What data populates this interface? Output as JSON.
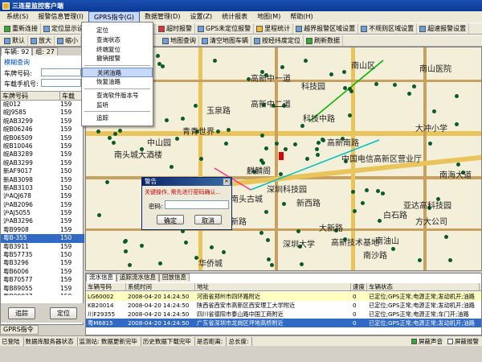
{
  "title": "三连星监控客户端",
  "menus": [
    "系统(S)",
    "报警信息管理(I)",
    "GPRS指令(G)",
    "数据管理(D)",
    "设置(Z)",
    "统计报表",
    "地图(M)",
    "帮助(H)"
  ],
  "toolbar1": [
    "重新连接",
    "定位显示设",
    "超时报警",
    "GPS未定位报警",
    "里程统计",
    "越界报警区域设置",
    "不规则区域设置",
    "超速报警设置"
  ],
  "toolbar2": [
    "默认",
    "放大",
    "缩小",
    "地图查询",
    "清空地图车辆",
    "按经纬度定位",
    "刷新数据"
  ],
  "dropdown": [
    "定位",
    "查询状态",
    "终端复位",
    "撤销报警",
    "关闭油路",
    "恢复油路",
    "查询软件版本号",
    "监听",
    "追踪"
  ],
  "left": {
    "tabs": [
      "车辆: 92",
      "组: 27"
    ],
    "title": "模糊查询",
    "search_label": "模糊查询",
    "plate_label": "车牌号码:",
    "sim_label": "车载手机号:",
    "col_plate": "车牌号码",
    "col_phone": "车载",
    "rows": [
      [
        "皖012",
        "159"
      ],
      [
        "皖J9585",
        "159"
      ],
      [
        "皖AB3299",
        "159"
      ],
      [
        "皖B06246",
        "159"
      ],
      [
        "皖B06509",
        "159"
      ],
      [
        "皖B10046",
        "159"
      ],
      [
        "皖AB3289",
        "159"
      ],
      [
        "皖AB3299",
        "159"
      ],
      [
        "新AF9017",
        "150"
      ],
      [
        "新AB3098",
        "159"
      ],
      [
        "新AB3103",
        "150"
      ],
      [
        "沪AQJ678",
        "159"
      ],
      [
        "沪AB2096",
        "159"
      ],
      [
        "沪AJ5055",
        "159"
      ],
      [
        "沪AB3296",
        "159"
      ],
      [
        "粤B9908",
        "159"
      ],
      [
        "粤B-355",
        "150"
      ],
      [
        "粤B3911",
        "159"
      ],
      [
        "粤B57735",
        "150"
      ],
      [
        "粤B3296",
        "159"
      ],
      [
        "粤B6006",
        "159"
      ],
      [
        "粤B70577",
        "159"
      ],
      [
        "粤B89055",
        "159"
      ],
      [
        "粤B00027",
        "159"
      ]
    ],
    "btn_track": "追踪",
    "btn_locate": "定位"
  },
  "bottom_tab": "GPRS指令",
  "map": {
    "tab": "地图",
    "labels": [
      "南山区",
      "高新中一道",
      "高新中二道",
      "玉泉路",
      "高新南路",
      "南山医院",
      "青青世界",
      "中山园",
      "深圳大学",
      "南油山",
      "大冲小学",
      "中国电信高新区营业厅",
      "南海大道",
      "新西路",
      "大新路",
      "科技园",
      "科技中路",
      "石化",
      "方大公司",
      "亚达高科技园",
      "南头城大酒楼",
      "南头古城",
      "华侨城",
      "深圳科技园",
      "白石路",
      "南沙路",
      "高新技术基地",
      "麒麟阁",
      "小新路"
    ]
  },
  "dialog": {
    "title": "警告",
    "message": "关键操作, 需先进行密码确认...",
    "password_label": "密码:",
    "ok": "确定",
    "cancel": "取消"
  },
  "info": {
    "tabs": [
      "流水信息",
      "追踪流水信息",
      "回放信息"
    ],
    "headers": [
      "车辆号码",
      "系统时间",
      "地址",
      "速度",
      "车辆状态"
    ],
    "rows": [
      [
        "LG60002",
        "2008-04-20 14:24:50",
        "河南省郑州市四环路附近",
        "0",
        "已定位;GPS正常;电源正常;发动机开;油路"
      ],
      [
        "KB20014",
        "2008-04-20 14:24:50",
        "陕西省西安市高新区西安理工大学附近",
        "0",
        "已定位;GPS正常;电源正常;发动机开;油路"
      ],
      [
        "川F29355",
        "2008-04-20 14:24:50",
        "四川省德阳市泰山路中国工商附近",
        "0",
        "已定位;GPS正常;电源正常;车门开;油路"
      ],
      [
        "粤M6815",
        "2008-04-20 14:24:50",
        "广东省深圳市龙岗区坪地高桥附近",
        "0",
        "已定位;GPS正常;电源正常;发动机开;油路"
      ]
    ]
  },
  "status": {
    "items": [
      "已登陆",
      "数据库服务器状态",
      "监测站: 数据更新完毕",
      "历史数据下载完毕",
      "是否距离:",
      "总长度:"
    ],
    "mute_label": "屏蔽声音",
    "mute_checked": true,
    "block_label": "屏蔽报警",
    "block_checked": false
  }
}
